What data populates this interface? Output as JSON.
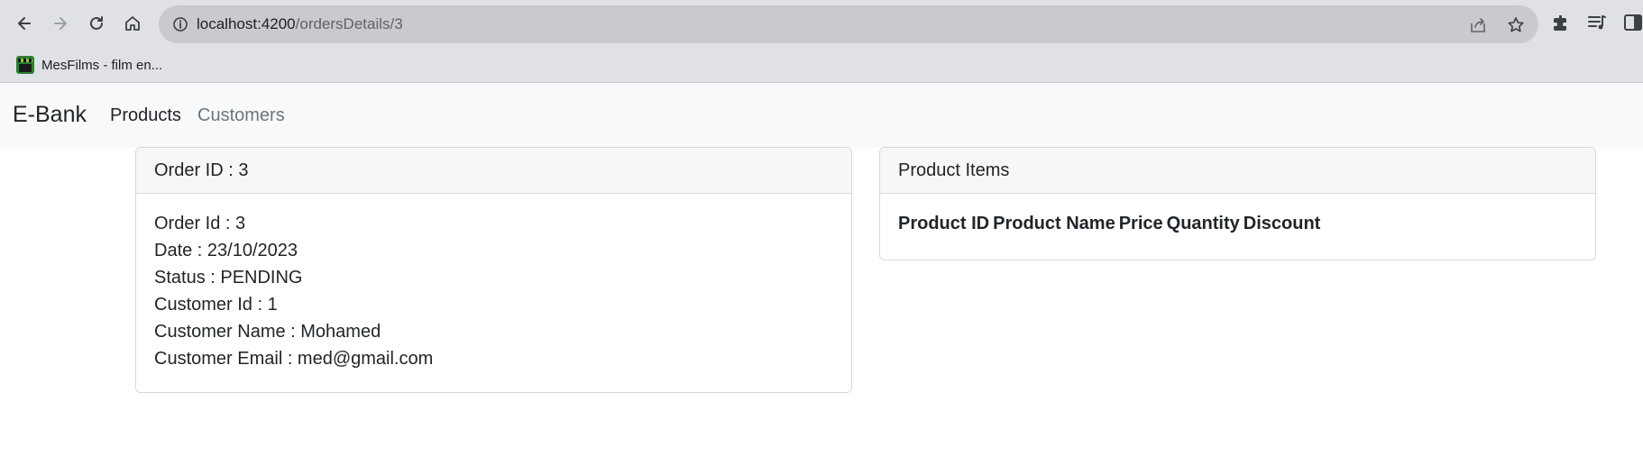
{
  "browser": {
    "url_host": "localhost:4200",
    "url_path": "/ordersDetails/3",
    "bookmark_label": "MesFilms - film en..."
  },
  "navbar": {
    "brand": "E-Bank",
    "links": [
      "Products",
      "Customers"
    ]
  },
  "order_card": {
    "header": "Order ID : 3",
    "lines": [
      "Order Id : 3",
      "Date : 23/10/2023",
      "Status : PENDING",
      "Customer Id : 1",
      "Customer Name : Mohamed",
      "Customer Email : med@gmail.com"
    ]
  },
  "products_card": {
    "header": "Product Items",
    "columns": [
      "Product ID",
      "Product Name",
      "Price",
      "Quantity",
      "Discount"
    ]
  },
  "colors": {
    "browser_toolbar": "#dfe1e5",
    "omnibox": "#c9cacd",
    "navbar_bg": "#f8f9fa",
    "muted_link": "#6c757d"
  },
  "icons": [
    "back-arrow-icon",
    "forward-arrow-icon",
    "reload-icon",
    "home-icon",
    "info-icon",
    "share-icon",
    "star-icon",
    "extensions-icon",
    "media-queue-icon",
    "side-panel-icon",
    "bookmark-favicon"
  ]
}
